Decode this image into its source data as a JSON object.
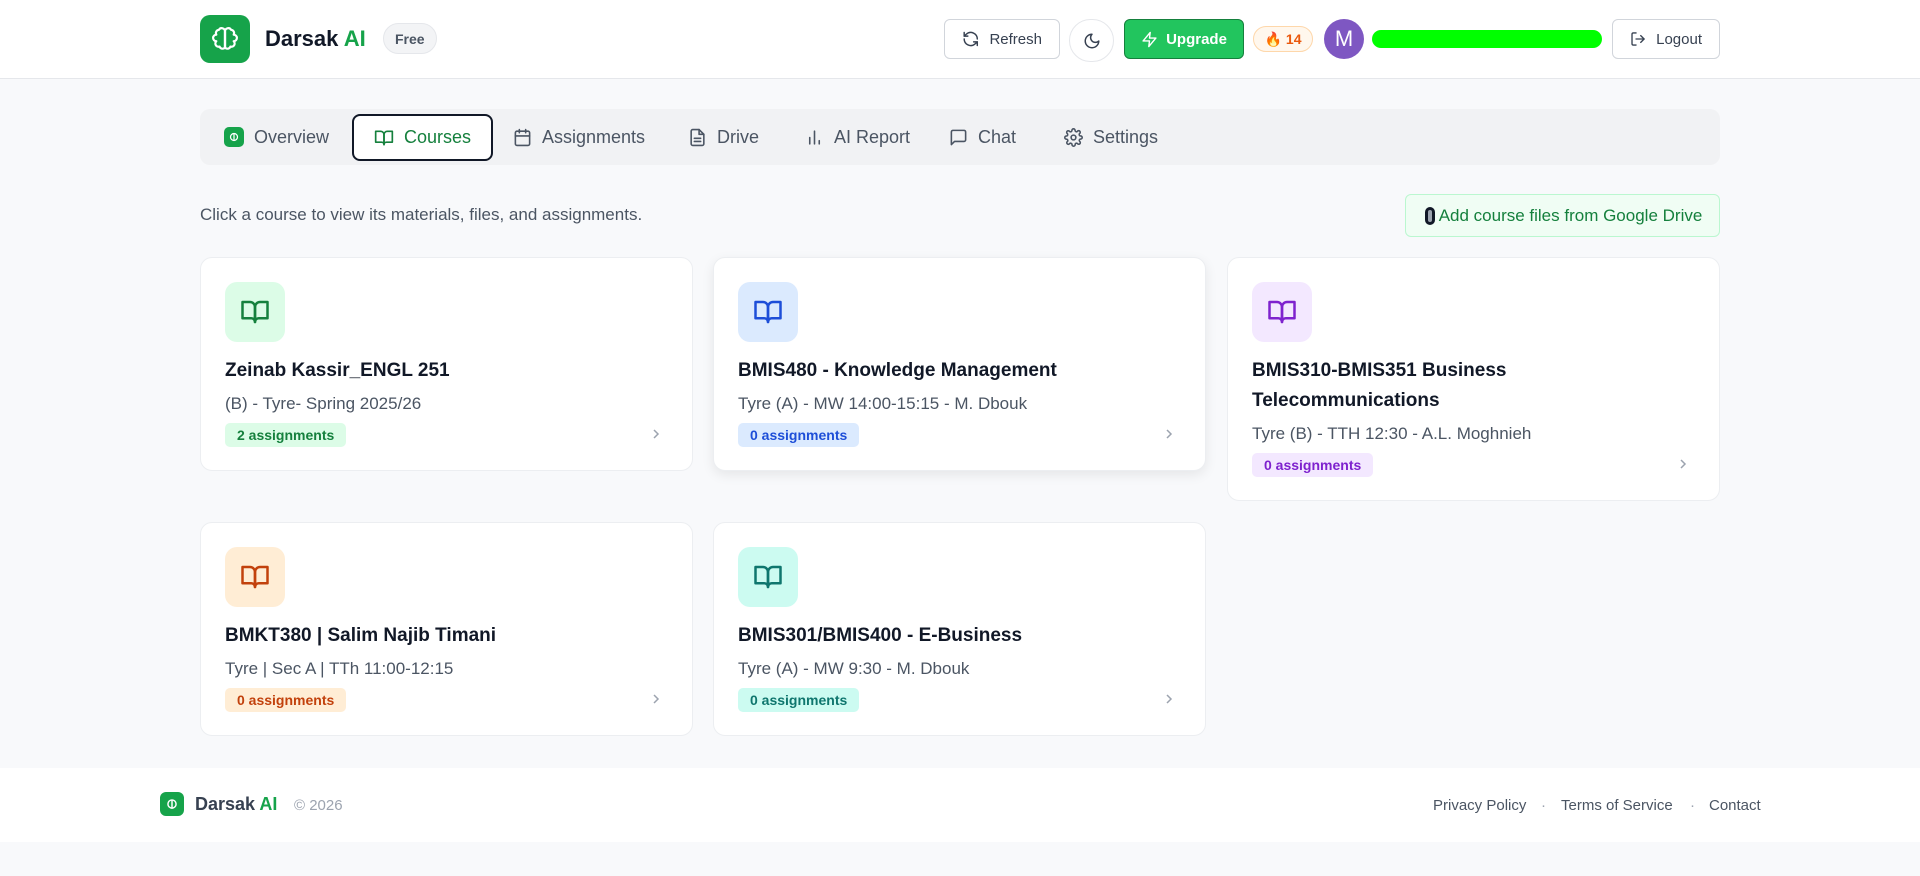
{
  "header": {
    "brand_name": "Darsak",
    "brand_suffix": "AI",
    "plan_badge": "Free",
    "refresh_label": "Refresh",
    "upgrade_label": "Upgrade",
    "streak_count": "14",
    "avatar_initial": "M",
    "user_name_redacted": "redacted",
    "logout_label": "Logout"
  },
  "nav": {
    "tabs": [
      {
        "label": "Overview",
        "icon": "brain-logo-icon",
        "active": false
      },
      {
        "label": "Courses",
        "icon": "book-open-icon",
        "active": true
      },
      {
        "label": "Assignments",
        "icon": "calendar-icon",
        "active": false
      },
      {
        "label": "Drive",
        "icon": "file-icon",
        "active": false
      },
      {
        "label": "AI Report",
        "icon": "bar-chart-icon",
        "active": false
      },
      {
        "label": "Chat",
        "icon": "message-square-icon",
        "active": false
      },
      {
        "label": "Settings",
        "icon": "gear-icon",
        "active": false
      }
    ]
  },
  "main": {
    "intro_text": "Click a course to view its materials, files, and assignments.",
    "drive_button_label": "Add course files from Google Drive"
  },
  "courses": [
    {
      "title": "Zeinab Kassir_ENGL 251",
      "subtitle": "(B) - Tyre- Spring 2025/26",
      "assignments": "2 assignments",
      "accent": "#15803d",
      "tint": "#dcfce7"
    },
    {
      "title": "BMIS480 - Knowledge Management",
      "subtitle": "Tyre (A) - MW 14:00-15:15 - M. Dbouk",
      "assignments": "0 assignments",
      "accent": "#1d4ed8",
      "tint": "#dbeafe"
    },
    {
      "title": "BMIS310-BMIS351 Business Telecommunications",
      "subtitle": "Tyre (B) - TTH 12:30 - A.L. Moghnieh",
      "assignments": "0 assignments",
      "accent": "#7e22ce",
      "tint": "#f3e8ff"
    },
    {
      "title": "BMKT380 | Salim Najib Timani",
      "subtitle": "Tyre | Sec A | TTh 11:00-12:15",
      "assignments": "0 assignments",
      "accent": "#c2410c",
      "tint": "#ffedd5"
    },
    {
      "title": "BMIS301/BMIS400 - E-Business",
      "subtitle": "Tyre (A) - MW 9:30 - M. Dbouk",
      "assignments": "0 assignments",
      "accent": "#0f766e",
      "tint": "#ccfbf1"
    }
  ],
  "footer": {
    "brand_name": "Darsak",
    "brand_suffix": "AI",
    "copyright": "© 2026",
    "links": [
      "Privacy Policy",
      "Terms of Service",
      "Contact"
    ]
  },
  "colors": {
    "brand_green": "#16a34a",
    "upgrade_green": "#22c55e",
    "avatar_purple": "#7e57c2"
  }
}
